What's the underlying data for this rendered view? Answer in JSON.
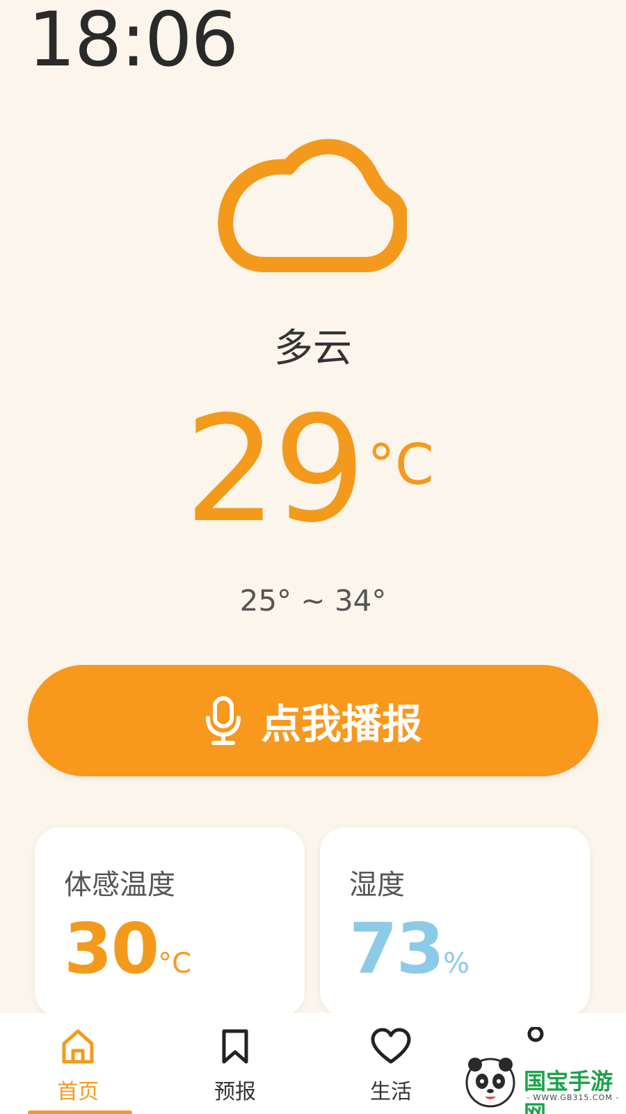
{
  "status_bar": {
    "time": "18:06"
  },
  "weather": {
    "icon": "cloud-icon",
    "condition": "多云",
    "temperature": "29",
    "temperature_unit": "°C",
    "range": "25° ~ 34°"
  },
  "speak_button": {
    "label": "点我播报",
    "icon": "microphone-icon"
  },
  "cards": {
    "feels_like": {
      "label": "体感温度",
      "value": "30",
      "unit": "°C"
    },
    "humidity": {
      "label": "湿度",
      "value": "73",
      "unit": "%"
    }
  },
  "tabbar": {
    "items": [
      {
        "label": "首页",
        "icon": "home-icon",
        "active": true
      },
      {
        "label": "预报",
        "icon": "bookmark-icon",
        "active": false
      },
      {
        "label": "生活",
        "icon": "heart-icon",
        "active": false
      },
      {
        "label": "",
        "icon": "circle-icon",
        "active": false
      }
    ]
  },
  "watermark": {
    "text": "国宝手游网",
    "url": "- WWW.GB315.COM -"
  },
  "colors": {
    "accent": "#f8981c",
    "background": "#fcf5ec",
    "humidity": "#8ccbe8"
  }
}
